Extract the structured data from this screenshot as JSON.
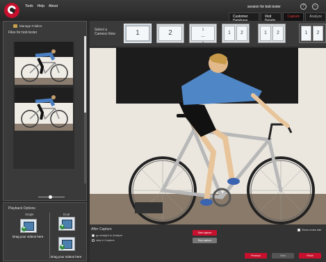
{
  "menu": [
    "Tools",
    "Help",
    "About"
  ],
  "session_title": "session for bob tester",
  "tabs": {
    "customer": "Customer Database",
    "visit": "Visit Details",
    "capture": "Capture",
    "analyze": "Analyze"
  },
  "files": {
    "manage": "Manage Folders",
    "label": "Files for bob tester"
  },
  "playback": {
    "title": "Playback Options",
    "single": "Single",
    "dual": "Dual",
    "drop_text": "Drag your videos here"
  },
  "camera": {
    "select_label": "Select a Camera View",
    "views": [
      "1",
      "2",
      "1/2",
      "1 2",
      "1 2",
      "1 2"
    ]
  },
  "after_capture": {
    "title": "After Capture",
    "option_analyze": "go straight to Analyze",
    "option_capture": "stay in Capture",
    "start": "Start capture",
    "stop": "Stop capture",
    "crosshair": "Show cross hair"
  },
  "footer": {
    "previous": "Previous",
    "next": "Next",
    "finish": "Finish"
  },
  "colors": {
    "accent": "#c8102e",
    "background": "#2b2b2b",
    "panel": "#3a3a3a"
  }
}
